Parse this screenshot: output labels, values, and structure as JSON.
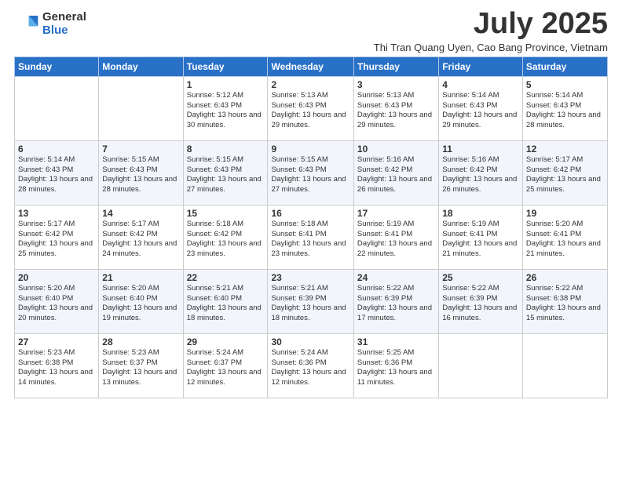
{
  "logo": {
    "general": "General",
    "blue": "Blue"
  },
  "title": "July 2025",
  "subtitle": "Thi Tran Quang Uyen, Cao Bang Province, Vietnam",
  "weekdays": [
    "Sunday",
    "Monday",
    "Tuesday",
    "Wednesday",
    "Thursday",
    "Friday",
    "Saturday"
  ],
  "weeks": [
    [
      {
        "day": "",
        "info": ""
      },
      {
        "day": "",
        "info": ""
      },
      {
        "day": "1",
        "info": "Sunrise: 5:12 AM\nSunset: 6:43 PM\nDaylight: 13 hours and 30 minutes."
      },
      {
        "day": "2",
        "info": "Sunrise: 5:13 AM\nSunset: 6:43 PM\nDaylight: 13 hours and 29 minutes."
      },
      {
        "day": "3",
        "info": "Sunrise: 5:13 AM\nSunset: 6:43 PM\nDaylight: 13 hours and 29 minutes."
      },
      {
        "day": "4",
        "info": "Sunrise: 5:14 AM\nSunset: 6:43 PM\nDaylight: 13 hours and 29 minutes."
      },
      {
        "day": "5",
        "info": "Sunrise: 5:14 AM\nSunset: 6:43 PM\nDaylight: 13 hours and 28 minutes."
      }
    ],
    [
      {
        "day": "6",
        "info": "Sunrise: 5:14 AM\nSunset: 6:43 PM\nDaylight: 13 hours and 28 minutes."
      },
      {
        "day": "7",
        "info": "Sunrise: 5:15 AM\nSunset: 6:43 PM\nDaylight: 13 hours and 28 minutes."
      },
      {
        "day": "8",
        "info": "Sunrise: 5:15 AM\nSunset: 6:43 PM\nDaylight: 13 hours and 27 minutes."
      },
      {
        "day": "9",
        "info": "Sunrise: 5:15 AM\nSunset: 6:43 PM\nDaylight: 13 hours and 27 minutes."
      },
      {
        "day": "10",
        "info": "Sunrise: 5:16 AM\nSunset: 6:42 PM\nDaylight: 13 hours and 26 minutes."
      },
      {
        "day": "11",
        "info": "Sunrise: 5:16 AM\nSunset: 6:42 PM\nDaylight: 13 hours and 26 minutes."
      },
      {
        "day": "12",
        "info": "Sunrise: 5:17 AM\nSunset: 6:42 PM\nDaylight: 13 hours and 25 minutes."
      }
    ],
    [
      {
        "day": "13",
        "info": "Sunrise: 5:17 AM\nSunset: 6:42 PM\nDaylight: 13 hours and 25 minutes."
      },
      {
        "day": "14",
        "info": "Sunrise: 5:17 AM\nSunset: 6:42 PM\nDaylight: 13 hours and 24 minutes."
      },
      {
        "day": "15",
        "info": "Sunrise: 5:18 AM\nSunset: 6:42 PM\nDaylight: 13 hours and 23 minutes."
      },
      {
        "day": "16",
        "info": "Sunrise: 5:18 AM\nSunset: 6:41 PM\nDaylight: 13 hours and 23 minutes."
      },
      {
        "day": "17",
        "info": "Sunrise: 5:19 AM\nSunset: 6:41 PM\nDaylight: 13 hours and 22 minutes."
      },
      {
        "day": "18",
        "info": "Sunrise: 5:19 AM\nSunset: 6:41 PM\nDaylight: 13 hours and 21 minutes."
      },
      {
        "day": "19",
        "info": "Sunrise: 5:20 AM\nSunset: 6:41 PM\nDaylight: 13 hours and 21 minutes."
      }
    ],
    [
      {
        "day": "20",
        "info": "Sunrise: 5:20 AM\nSunset: 6:40 PM\nDaylight: 13 hours and 20 minutes."
      },
      {
        "day": "21",
        "info": "Sunrise: 5:20 AM\nSunset: 6:40 PM\nDaylight: 13 hours and 19 minutes."
      },
      {
        "day": "22",
        "info": "Sunrise: 5:21 AM\nSunset: 6:40 PM\nDaylight: 13 hours and 18 minutes."
      },
      {
        "day": "23",
        "info": "Sunrise: 5:21 AM\nSunset: 6:39 PM\nDaylight: 13 hours and 18 minutes."
      },
      {
        "day": "24",
        "info": "Sunrise: 5:22 AM\nSunset: 6:39 PM\nDaylight: 13 hours and 17 minutes."
      },
      {
        "day": "25",
        "info": "Sunrise: 5:22 AM\nSunset: 6:39 PM\nDaylight: 13 hours and 16 minutes."
      },
      {
        "day": "26",
        "info": "Sunrise: 5:22 AM\nSunset: 6:38 PM\nDaylight: 13 hours and 15 minutes."
      }
    ],
    [
      {
        "day": "27",
        "info": "Sunrise: 5:23 AM\nSunset: 6:38 PM\nDaylight: 13 hours and 14 minutes."
      },
      {
        "day": "28",
        "info": "Sunrise: 5:23 AM\nSunset: 6:37 PM\nDaylight: 13 hours and 13 minutes."
      },
      {
        "day": "29",
        "info": "Sunrise: 5:24 AM\nSunset: 6:37 PM\nDaylight: 13 hours and 12 minutes."
      },
      {
        "day": "30",
        "info": "Sunrise: 5:24 AM\nSunset: 6:36 PM\nDaylight: 13 hours and 12 minutes."
      },
      {
        "day": "31",
        "info": "Sunrise: 5:25 AM\nSunset: 6:36 PM\nDaylight: 13 hours and 11 minutes."
      },
      {
        "day": "",
        "info": ""
      },
      {
        "day": "",
        "info": ""
      }
    ]
  ]
}
